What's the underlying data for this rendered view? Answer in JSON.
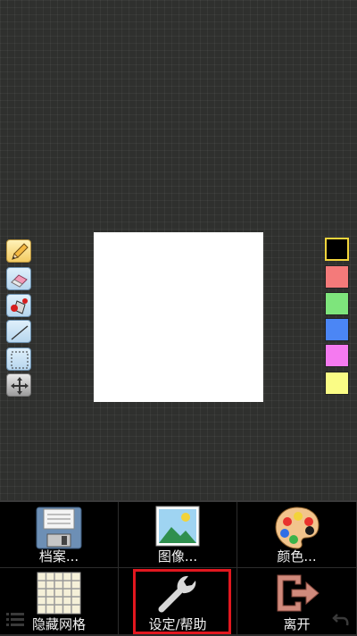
{
  "tools": [
    {
      "name": "pencil-tool",
      "icon": "pencil-icon",
      "selected": true
    },
    {
      "name": "eraser-tool",
      "icon": "eraser-icon",
      "selected": false
    },
    {
      "name": "fill-tool",
      "icon": "paint-bucket-icon",
      "selected": false
    },
    {
      "name": "line-tool",
      "icon": "line-icon",
      "selected": false
    },
    {
      "name": "select-tool",
      "icon": "dashed-rect-icon",
      "selected": false
    },
    {
      "name": "move-tool",
      "icon": "move-arrows-icon",
      "selected": false
    }
  ],
  "palette": [
    {
      "name": "black",
      "color": "#000000",
      "selected": true
    },
    {
      "name": "red",
      "color": "#f47a7a",
      "selected": false
    },
    {
      "name": "green",
      "color": "#7ee57c",
      "selected": false
    },
    {
      "name": "blue",
      "color": "#4b86f5",
      "selected": false
    },
    {
      "name": "magenta",
      "color": "#f57af0",
      "selected": false
    },
    {
      "name": "yellow",
      "color": "#fafc85",
      "selected": false
    }
  ],
  "menu": {
    "file": "档案...",
    "image": "图像...",
    "color": "颜色...",
    "hide_grid": "隐藏网格",
    "settings": "设定/帮助",
    "exit": "离开"
  },
  "highlight_color": "#e2171f"
}
